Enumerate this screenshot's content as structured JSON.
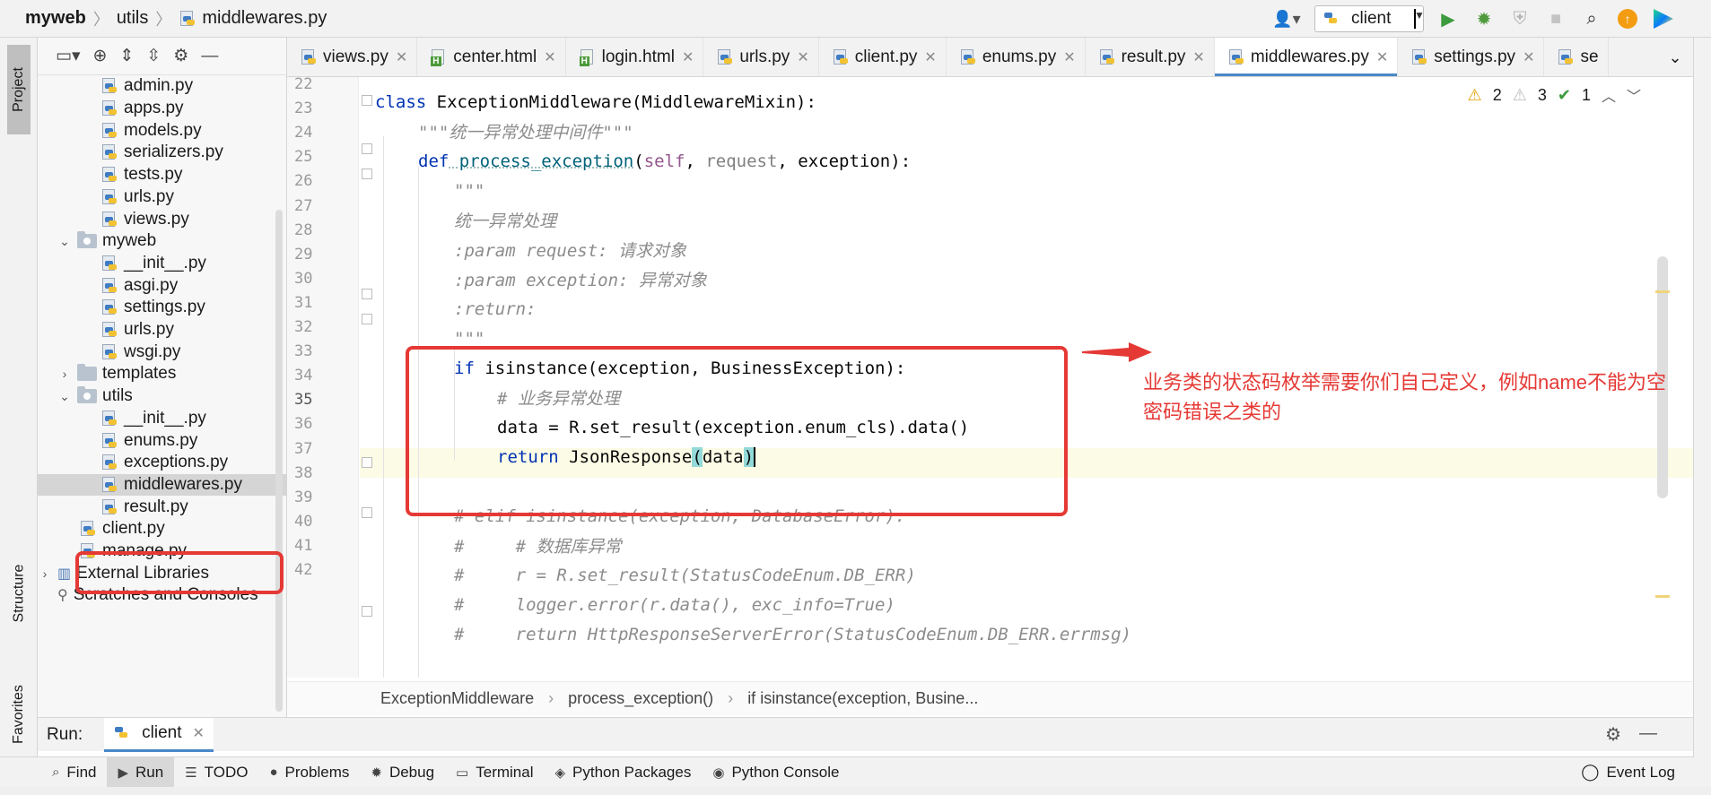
{
  "breadcrumb": {
    "root": "myweb",
    "folder": "utils",
    "file": "middlewares.py"
  },
  "toolbar": {
    "run_config": "client",
    "run_config_icon": "python-icon"
  },
  "left_strip": {
    "project": "Project",
    "structure": "Structure",
    "favorites": "Favorites"
  },
  "project_tree": [
    {
      "label": "admin.py",
      "kind": "py",
      "indent": 2
    },
    {
      "label": "apps.py",
      "kind": "py",
      "indent": 2
    },
    {
      "label": "models.py",
      "kind": "py",
      "indent": 2
    },
    {
      "label": "serializers.py",
      "kind": "py",
      "indent": 2
    },
    {
      "label": "tests.py",
      "kind": "py",
      "indent": 2
    },
    {
      "label": "urls.py",
      "kind": "py",
      "indent": 2
    },
    {
      "label": "views.py",
      "kind": "py",
      "indent": 2
    },
    {
      "label": "myweb",
      "kind": "folder-open",
      "indent": 1
    },
    {
      "label": "__init__.py",
      "kind": "py",
      "indent": 2
    },
    {
      "label": "asgi.py",
      "kind": "py",
      "indent": 2
    },
    {
      "label": "settings.py",
      "kind": "py",
      "indent": 2
    },
    {
      "label": "urls.py",
      "kind": "py",
      "indent": 2
    },
    {
      "label": "wsgi.py",
      "kind": "py",
      "indent": 2
    },
    {
      "label": "templates",
      "kind": "folder-closed",
      "indent": 1
    },
    {
      "label": "utils",
      "kind": "folder-open",
      "indent": 1
    },
    {
      "label": "__init__.py",
      "kind": "py",
      "indent": 2
    },
    {
      "label": "enums.py",
      "kind": "py",
      "indent": 2
    },
    {
      "label": "exceptions.py",
      "kind": "py",
      "indent": 2
    },
    {
      "label": "middlewares.py",
      "kind": "py",
      "indent": 2,
      "selected": true
    },
    {
      "label": "result.py",
      "kind": "py",
      "indent": 2
    },
    {
      "label": "client.py",
      "kind": "py",
      "indent": 1
    },
    {
      "label": "manage.py",
      "kind": "py",
      "indent": 1
    },
    {
      "label": "External Libraries",
      "kind": "lib",
      "indent": 0
    },
    {
      "label": "Scratches and Consoles",
      "kind": "scratch",
      "indent": 0
    }
  ],
  "tabs": [
    {
      "label": "views.py",
      "kind": "py"
    },
    {
      "label": "center.html",
      "kind": "html"
    },
    {
      "label": "login.html",
      "kind": "html"
    },
    {
      "label": "urls.py",
      "kind": "py"
    },
    {
      "label": "client.py",
      "kind": "py"
    },
    {
      "label": "enums.py",
      "kind": "py"
    },
    {
      "label": "result.py",
      "kind": "py"
    },
    {
      "label": "middlewares.py",
      "kind": "py",
      "active": true
    },
    {
      "label": "settings.py",
      "kind": "py"
    },
    {
      "label": "se",
      "kind": "py"
    }
  ],
  "inspections": {
    "warnings": "2",
    "weak_warnings": "3",
    "typos": "1"
  },
  "code": {
    "line_numbers": [
      "22",
      "23",
      "24",
      "25",
      "26",
      "27",
      "28",
      "29",
      "30",
      "31",
      "32",
      "33",
      "34",
      "35",
      "36",
      "37",
      "38",
      "39",
      "40",
      "41",
      "42"
    ],
    "current_line": "35",
    "l23": {
      "kw": "class",
      "name": " ExceptionMiddleware",
      "rest": "(MiddlewareMixin):"
    },
    "l24": "\"\"\"统一异常处理中间件\"\"\"",
    "l25": {
      "kw": "def",
      "fn": " process_exception",
      "p1": "(",
      "self": "self",
      "c1": ", ",
      "req": "request",
      "rest": ", exception):"
    },
    "l26": "\"\"\"",
    "l27": "统一异常处理",
    "l28": ":param request: 请求对象",
    "l29": ":param exception: 异常对象",
    "l30": ":return:",
    "l31": "\"\"\"",
    "l32": {
      "kw": "if",
      "rest": " isinstance(exception, BusinessException):"
    },
    "l33": "# 业务异常处理",
    "l34": "data = R.set_result(exception.enum_cls).data()",
    "l35": {
      "kw": "return",
      "call": " JsonResponse",
      "open": "(",
      "arg": "data",
      "close": ")"
    },
    "l37": "# elif isinstance(exception, DatabaseError):",
    "l38": "#     # 数据库异常",
    "l39": "#     r = R.set_result(StatusCodeEnum.DB_ERR)",
    "l40": "#     logger.error(r.data(), exc_info=True)",
    "l41": "#     return HttpResponseServerError(StatusCodeEnum.DB_ERR.errmsg)"
  },
  "annotation": {
    "line1": "业务类的状态码枚举需要你们自己定义，例如name不能为空",
    "line2": "密码错误之类的"
  },
  "code_breadcrumbs": [
    "ExceptionMiddleware",
    "process_exception()",
    "if isinstance(exception, Busine..."
  ],
  "run_bar": {
    "label": "Run:",
    "config": "client"
  },
  "bottom_tools": [
    "Find",
    "Run",
    "TODO",
    "Problems",
    "Debug",
    "Terminal",
    "Python Packages",
    "Python Console"
  ],
  "event_log": "Event Log",
  "colors": {
    "accent": "#4a88c7",
    "annotation_red": "#e53935",
    "keyword": "#0033b3"
  }
}
